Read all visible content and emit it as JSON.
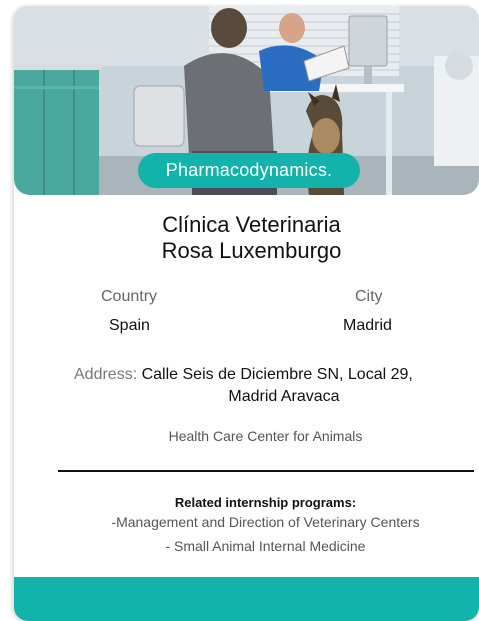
{
  "card": {
    "category_badge": "Pharmacodynamics.",
    "title_line1": "Clínica Veterinaria",
    "title_line2": "Rosa Luxemburgo",
    "country_label": "Country",
    "country_value": "Spain",
    "city_label": "City",
    "city_value": "Madrid",
    "address_label": "Address:",
    "address_line1": "Calle Seis de Diciembre SN, Local 29,",
    "address_line2": "Madrid Aravaca",
    "subtitle": "Health Care Center for Animals",
    "related_heading": "Related internship programs:",
    "programs": [
      "-Management and Direction of Veterinary Centers",
      "- Small Animal Internal Medicine"
    ]
  },
  "colors": {
    "accent": "#12b3aa",
    "text": "#111111",
    "muted": "#666666"
  }
}
